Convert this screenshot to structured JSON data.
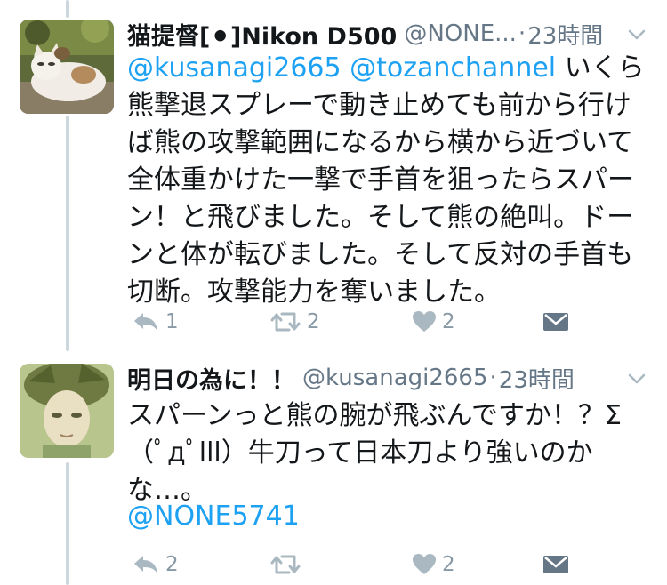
{
  "tweets": [
    {
      "display_name": "猫提督[⚫]Nikon D500",
      "handle": "@NONE...",
      "separator": "·",
      "time": "23時間",
      "mentions": [
        "@kusanagi2665",
        "@tozanchannel"
      ],
      "text": " いくら熊撃退スプレーで動き止めても前から行けば熊の攻撃範囲になるから横から近づいて全体重かけた一撃で手首を狙ったらスパーン！と飛びました。そして熊の絶叫。ドーンと体が転びました。そして反対の手首も切断。攻撃能力を奪いました。",
      "reply_count": "1",
      "retweet_count": "2",
      "like_count": "2"
    },
    {
      "display_name": "明日の為に！！",
      "handle": "@kusanagi2665",
      "separator": "·",
      "time": "23時間",
      "text": "スパーンっと熊の腕が飛ぶんですか！？Σ（ﾟдﾟlll）牛刀って日本刀より強いのかな…。",
      "mention_line": "@NONE5741",
      "reply_count": "2",
      "retweet_count": "",
      "like_count": "2"
    }
  ],
  "icons": {
    "reply": "reply-icon",
    "retweet": "retweet-icon",
    "like": "heart-icon",
    "dm": "envelope-icon",
    "more": "chevron-down-icon"
  },
  "colors": {
    "link": "#1da1f2",
    "muted": "#657786",
    "icon": "#aab8c2",
    "thread": "#ccd6dd"
  }
}
